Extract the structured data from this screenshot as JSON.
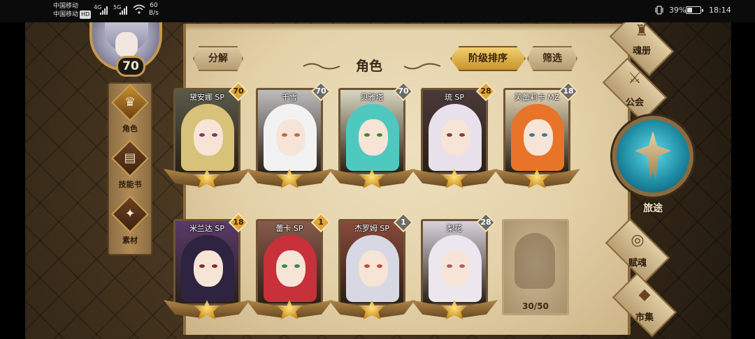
{
  "status_bar": {
    "carrier_line1": "中国移动",
    "carrier_line2": "中国移动",
    "hd": "HD",
    "signal1_type": "4G",
    "signal2_type": "5G",
    "net_speed_value": "60",
    "net_speed_unit": "B/s",
    "battery_pct": "39%",
    "battery_level": 0.39,
    "time": "18:14"
  },
  "player": {
    "level": "70"
  },
  "left_nav": {
    "items": [
      {
        "label": "角色",
        "icon": "character-crest-icon",
        "active": true
      },
      {
        "label": "技能书",
        "icon": "skill-book-icon",
        "active": false
      },
      {
        "label": "素材",
        "icon": "material-icon",
        "active": false
      }
    ]
  },
  "header": {
    "decompose_label": "分解",
    "title": "角色",
    "sort_label": "阶级排序",
    "filter_label": "筛选"
  },
  "characters": [
    {
      "name": "黛安娜 SP",
      "level": "70",
      "badge_color": "#e0a43a",
      "hair": "#d8c27a",
      "bg": "#5a5a4a",
      "eye": "#7a3a6a"
    },
    {
      "name": "千雪",
      "level": "70",
      "badge_color": "#6b6b6b",
      "hair": "#f2f2f2",
      "bg": "#bdbdbd",
      "eye": "#c06a4a"
    },
    {
      "name": "贝雅塔",
      "level": "70",
      "badge_color": "#6b6b6b",
      "hair": "#4fc9c0",
      "bg": "#d9d6c0",
      "eye": "#3f8a2a"
    },
    {
      "name": "琉 SP",
      "level": "28",
      "badge_color": "#e0a43a",
      "hair": "#e8e0ea",
      "bg": "#4a3a3a",
      "eye": "#8a3a3a"
    },
    {
      "name": "芙蕾莉卡 MZ",
      "level": "18",
      "badge_color": "#6b6b6b",
      "hair": "#e8742a",
      "bg": "#e6d8b8",
      "eye": "#3a7a9a"
    },
    {
      "name": "米兰达 SP",
      "level": "18",
      "badge_color": "#e0a43a",
      "hair": "#2e2340",
      "bg": "#5a3a6a",
      "eye": "#8a2a2a"
    },
    {
      "name": "蕾卡 SP",
      "level": "1",
      "badge_color": "#e0a43a",
      "hair": "#c8303a",
      "bg": "#8a5a4a",
      "eye": "#3a8a3a"
    },
    {
      "name": "杰罗姆 SP",
      "level": "1",
      "badge_color": "#6b6b6b",
      "hair": "#d8d8e4",
      "bg": "#8a4a3a",
      "eye": "#c04a3a"
    },
    {
      "name": "梨花",
      "level": "28",
      "badge_color": "#6b6b6b",
      "hair": "#ece6ee",
      "bg": "#d8d2dc",
      "eye": "#b05a6a"
    }
  ],
  "empty_slot": {
    "count": "30/50"
  },
  "right_menu": {
    "soul_book": "魂册",
    "guild": "公会",
    "journey": "旅途",
    "endow_soul": "赋魂",
    "market": "市集"
  }
}
